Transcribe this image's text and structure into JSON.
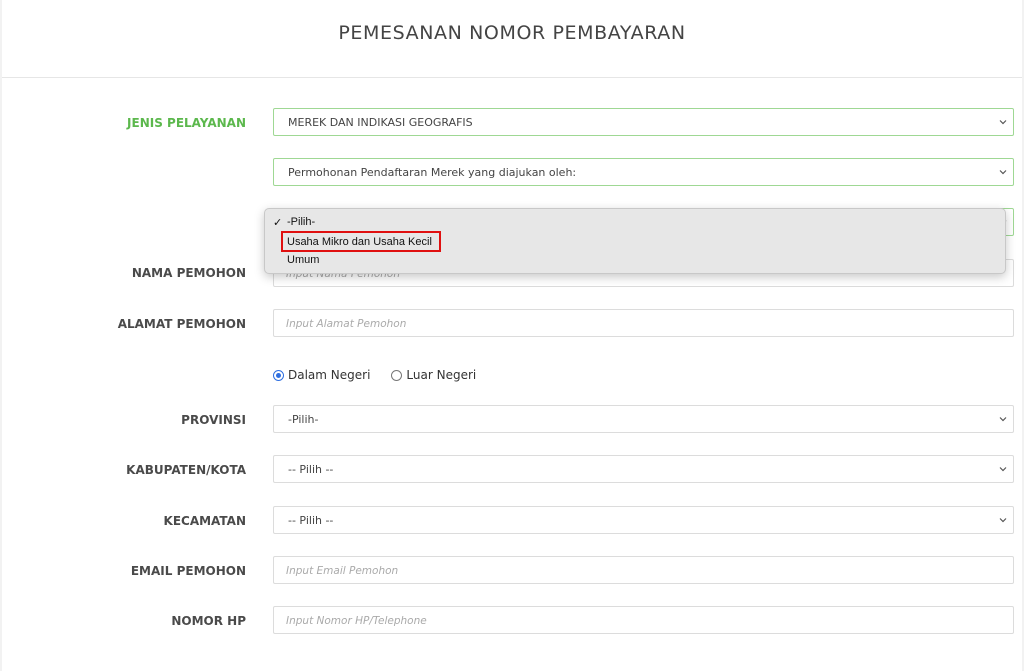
{
  "page": {
    "title": "PEMESANAN NOMOR PEMBAYARAN"
  },
  "form": {
    "jenis_pelayanan": {
      "label": "JENIS PELAYANAN",
      "value": "MEREK DAN INDIKASI GEOGRAFIS"
    },
    "permohonan": {
      "value": "Permohonan Pendaftaran Merek yang diajukan oleh:"
    },
    "pemohon_type_dropdown": {
      "options": [
        "-Pilih-",
        "Usaha Mikro dan Usaha Kecil",
        "Umum"
      ],
      "selected": "-Pilih-",
      "checkmark": "✓",
      "highlighted": "Usaha Mikro dan Usaha Kecil"
    },
    "nama": {
      "label": "NAMA PEMOHON",
      "placeholder": "Input Nama Pemohon"
    },
    "alamat": {
      "label": "ALAMAT PEMOHON",
      "placeholder": "Input Alamat Pemohon"
    },
    "negeri": {
      "options": [
        "Dalam Negeri",
        "Luar Negeri"
      ],
      "selected": "Dalam Negeri"
    },
    "provinsi": {
      "label": "PROVINSI",
      "value": "-Pilih-"
    },
    "kabupaten": {
      "label": "KABUPATEN/KOTA",
      "value": "-- Pilih --"
    },
    "kecamatan": {
      "label": "KECAMATAN",
      "value": "-- Pilih --"
    },
    "email": {
      "label": "EMAIL PEMOHON",
      "placeholder": "Input Email Pemohon"
    },
    "hp": {
      "label": "NOMOR HP",
      "placeholder": "Input Nomor HP/Telephone"
    }
  },
  "colors": {
    "accent_green": "#5cb84d",
    "field_green_border": "#9fd894",
    "highlight_red": "#e01010",
    "radio_blue": "#2f6fe0"
  },
  "icons": {
    "select_arrow": "chevron-down-icon",
    "selected_option": "checkmark-icon"
  }
}
